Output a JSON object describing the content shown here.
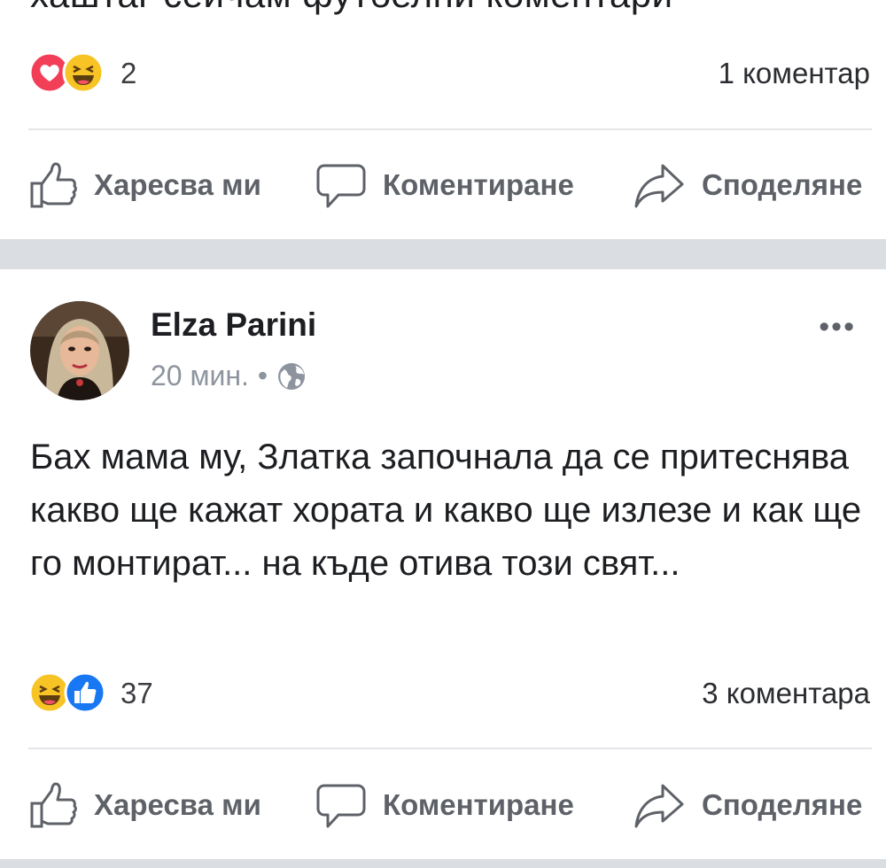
{
  "post1": {
    "cut_text": "хаштаг сейчам футбелни коментари",
    "reactions": {
      "icons": [
        "love-icon",
        "haha-icon"
      ],
      "count": "2"
    },
    "comments": "1 коментар",
    "actions": {
      "like": "Харесва ми",
      "comment": "Коментиране",
      "share": "Споделяне"
    }
  },
  "post2": {
    "author": "Elza Parini",
    "time": "20 мин.",
    "dot": "•",
    "privacy_icon": "globe-icon",
    "more_label": "•••",
    "text": "Бах мама му, Златка започнала да се притеснява какво ще кажат хората и какво ще излезе и как ще го монтират... на къде отива този свят...",
    "reactions": {
      "icons": [
        "haha-icon",
        "like-icon"
      ],
      "count": "37"
    },
    "comments": "3 коментара",
    "actions": {
      "like": "Харесва ми",
      "comment": "Коментиране",
      "share": "Споделяне"
    }
  },
  "colors": {
    "love": "#f33e58",
    "haha": "#f7b125",
    "like_blue": "#1877f2",
    "action_gray": "#5e6268",
    "separator": "#dadde1"
  }
}
